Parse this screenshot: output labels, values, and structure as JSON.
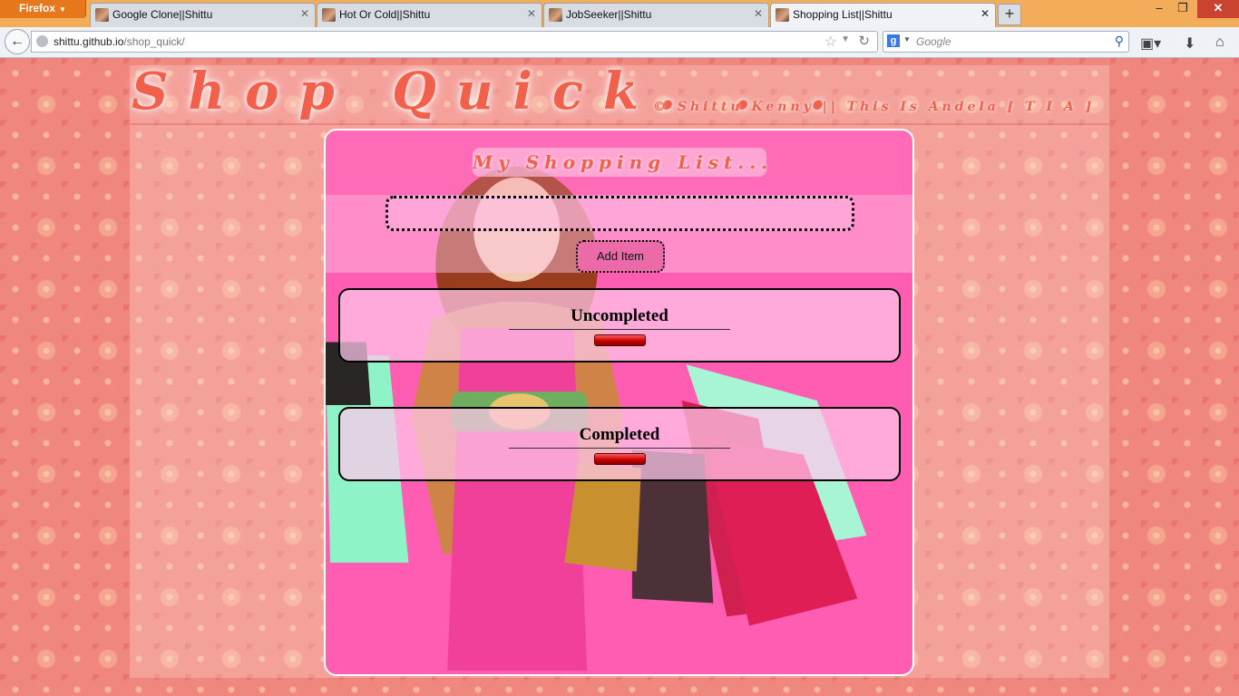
{
  "browser": {
    "menu_button": "Firefox",
    "tabs": [
      {
        "title": "Google Clone||Shittu",
        "active": false
      },
      {
        "title": "Hot Or Cold||Shittu",
        "active": false
      },
      {
        "title": "JobSeeker||Shittu",
        "active": false
      },
      {
        "title": "Shopping List||Shittu",
        "active": true
      }
    ],
    "url_host": "shittu.github.io",
    "url_path": "/shop_quick/",
    "search_placeholder": "Google"
  },
  "page": {
    "site_title": "Shop Quick. . .",
    "credit": "© Shittu Kenny || This Is Andela [ T I A ]",
    "list_heading": "My Shopping List...",
    "item_input_value": "",
    "add_button": "Add Item",
    "groups": [
      {
        "label": "Uncompleted"
      },
      {
        "label": "Completed"
      }
    ]
  },
  "colors": {
    "accent_title": "#f0604a",
    "panel_bg": "#ff5db1",
    "add_button": "#ec6aa8",
    "toggle_button": "#c80000",
    "firefox_orange": "#e6781b"
  }
}
